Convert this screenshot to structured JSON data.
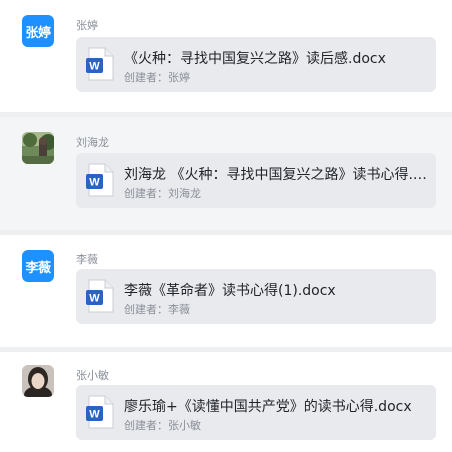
{
  "colors": {
    "avatar_blue": "#1e90ff",
    "word_blue": "#2b63c4",
    "page_bg": "#eeeff1"
  },
  "posts": [
    {
      "author": "张婷",
      "avatar_text": "张婷",
      "file_name": "《火种：寻找中国复兴之路》读后感.docx",
      "creator_label": "创建者：张婷",
      "file_icon": "word-doc-icon"
    },
    {
      "author": "刘海龙",
      "avatar_text": "",
      "file_name": "刘海龙 《火种：寻找中国复兴之路》读书心得.docx",
      "creator_label": "创建者：刘海龙",
      "file_icon": "word-doc-icon"
    },
    {
      "author": "李薇",
      "avatar_text": "李薇",
      "file_name": "李薇《革命者》读书心得(1).docx",
      "creator_label": "创建者：李薇",
      "file_icon": "word-doc-icon"
    },
    {
      "author": "张小敏",
      "avatar_text": "",
      "file_name": "廖乐瑜+《读懂中国共产党》的读书心得.docx",
      "creator_label": "创建者：张小敏",
      "file_icon": "word-doc-icon"
    }
  ]
}
